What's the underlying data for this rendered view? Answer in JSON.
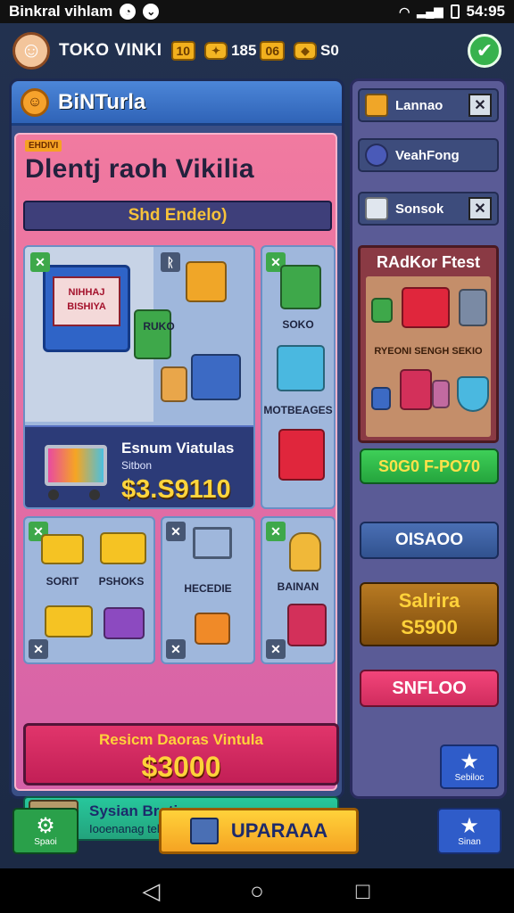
{
  "status_bar": {
    "left_text": "Binkral vihlam",
    "time": "54:95"
  },
  "top_bar": {
    "store_name": "TOKO VINKI",
    "level": "10",
    "coins": "185",
    "gems_chip": "06",
    "gems": "S0"
  },
  "left_panel": {
    "title": "BiNTurla",
    "pink_tag": "EHDIVI",
    "heading": "Dlentj raoh Vikilia",
    "sub_label": "Shd Endelo)",
    "tile_labels": {
      "ruko": "RUKO",
      "soko": "SOKO",
      "moibeages": "MOTBEAGES",
      "sorit": "SORIT",
      "pshoks": "PSHOKS",
      "hecedie": "HECEDIE",
      "bainan": "BAINAN"
    },
    "featured": {
      "board_text": "NIHHAJ BISHIYA",
      "name": "Esnum Viatulas",
      "sub": "Sitbon",
      "price": "$3.S9110"
    },
    "total": {
      "label": "Resicm Daoras Vintula",
      "value": "$3000"
    },
    "system": {
      "title": "Sysian Brotiaa",
      "subtitle": "Iooenanag telin Baileay"
    }
  },
  "right_panel": {
    "items": [
      {
        "label": "Lannao"
      },
      {
        "label": "VeahFong"
      },
      {
        "label": "Sonsok"
      }
    ],
    "featured_title": "RAdKor Ftest",
    "featured_labels": "RYEONI SENGH SEKIO",
    "btn_green": "S0G0 F-PO70",
    "btn_blue": "OISAOO",
    "gold_line1": "Salrira",
    "gold_line2": "S5900",
    "btn_red": "SNFLOO",
    "star_label": "Sebiloc"
  },
  "bottom_bar": {
    "settings_label": "Spaoi",
    "upgrade_label": "UPARAAA",
    "share_label": "Sinan"
  },
  "icons": [
    "gear-icon",
    "star-icon",
    "check-icon",
    "close-icon",
    "cart-icon",
    "back-icon",
    "home-icon",
    "recents-icon"
  ],
  "colors": {
    "accent_gold": "#ffd23a",
    "accent_pink": "#f17aa0",
    "accent_green": "#37b24d",
    "panel_blue": "#3a4f86"
  }
}
